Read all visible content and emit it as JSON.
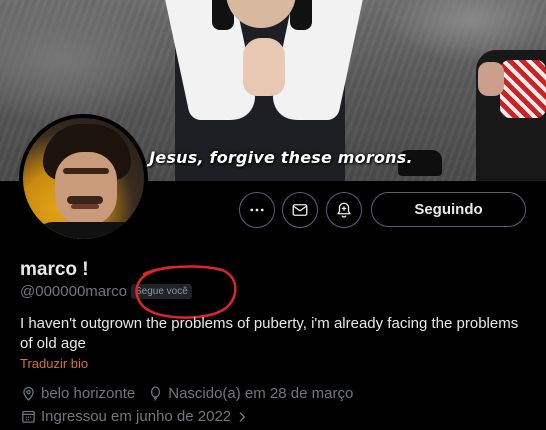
{
  "banner": {
    "caption": "Jesus, forgive these morons."
  },
  "actions": {
    "more_icon": "more-horizontal-icon",
    "message_icon": "envelope-icon",
    "notify_icon": "bell-plus-icon",
    "follow_label": "Seguindo"
  },
  "profile": {
    "name": "marco !",
    "handle": "@000000marco",
    "follows_you_badge": "Segue você",
    "bio": "I haven't outgrown the problems of puberty, i'm already facing the problems of old age",
    "translate_bio": "Traduzir bio",
    "location": "belo horizonte",
    "birthday": "Nascido(a) em 28 de março",
    "joined": "Ingressou em junho de 2022"
  },
  "colors": {
    "background": "#000000",
    "text_primary": "#e7e9ea",
    "text_secondary": "#71767b",
    "translate_link": "#d8702f",
    "annotation_circle": "#e0242b"
  }
}
